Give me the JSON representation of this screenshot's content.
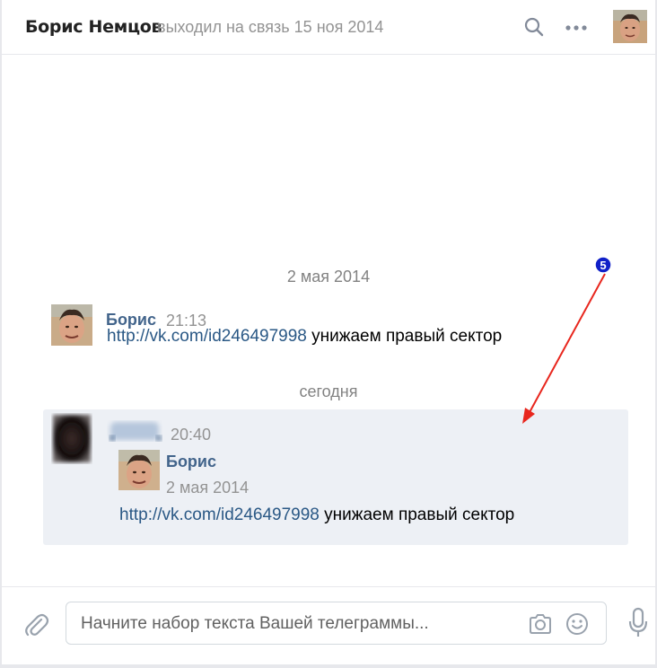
{
  "header": {
    "contact_name": "Борис Немцов",
    "last_seen": "выходил на связь 15 ноя 2014",
    "search_icon": "search-icon",
    "more_icon": "more-icon"
  },
  "conversation": {
    "date_separator_1": "2 мая 2014",
    "message_1": {
      "sender": "Борис",
      "time": "21:13",
      "link": "http://vk.com/id246497998",
      "text": " унижаем правый сектор"
    },
    "date_separator_2": "сегодня",
    "message_2": {
      "time": "20:40",
      "forwarded": {
        "sender": "Борис",
        "date": "2 мая 2014",
        "link": "http://vk.com/id246497998",
        "text": " унижаем правый сектор"
      }
    }
  },
  "annotation": {
    "badge_number": "5",
    "arrow_color": "#e8261d",
    "badge_color": "#1020c8"
  },
  "composer": {
    "placeholder": "Начните набор текста Вашей телеграммы...",
    "attach_icon": "paperclip-icon",
    "camera_icon": "camera-icon",
    "emoji_icon": "smile-icon",
    "voice_icon": "microphone-icon"
  },
  "colors": {
    "link": "#2a5885",
    "sender_name": "#42648b",
    "selected_bg": "#edf0f5"
  }
}
